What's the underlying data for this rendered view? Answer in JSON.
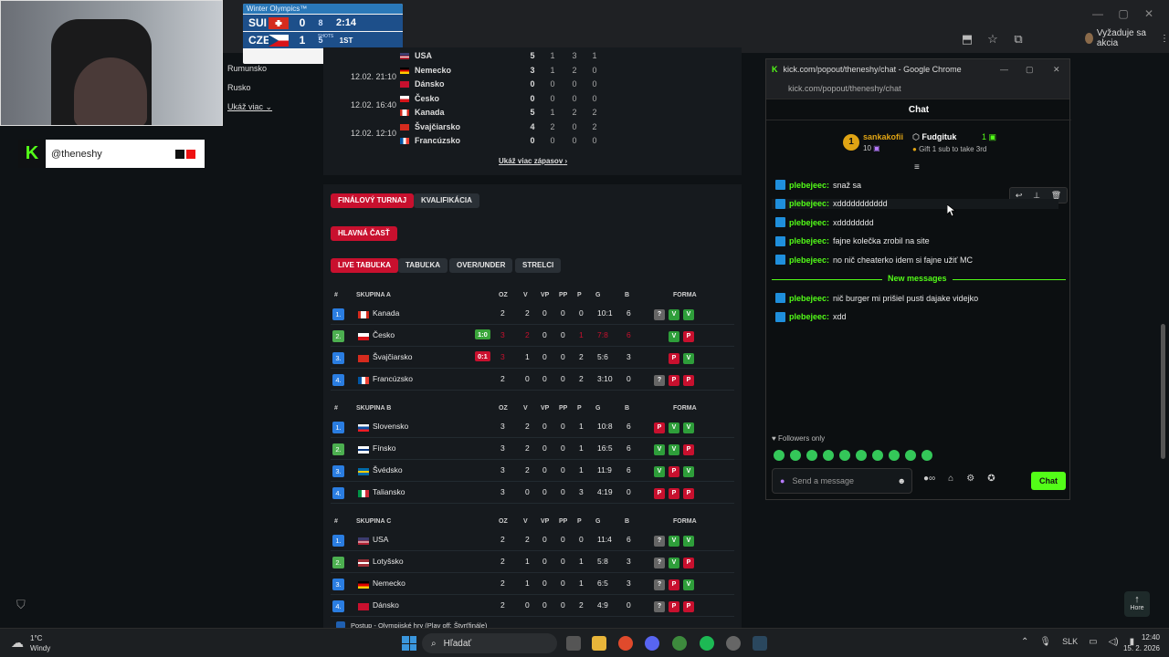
{
  "browser": {
    "action_label": "Vyžaduje sa akcia"
  },
  "scoreboard": {
    "header": "Winter Olympics™",
    "rows": [
      {
        "team": "SUI",
        "score": "0",
        "shots": "8",
        "clock": "2:14"
      },
      {
        "team": "CZE",
        "score": "1",
        "shots": "5",
        "clock": "1ST"
      }
    ],
    "shots_label": "SHOTS"
  },
  "channel": {
    "name": "@theneshy"
  },
  "side_list": [
    "Rumunsko",
    "Rusko",
    "Ukáž viac"
  ],
  "matches": {
    "rows": [
      {
        "time": "",
        "teams": [
          {
            "name": "USA",
            "nums": [
              "5",
              "1",
              "3",
              "1"
            ]
          }
        ]
      },
      {
        "time": "12.02. 21:10",
        "teams": [
          {
            "name": "Nemecko",
            "nums": [
              "3",
              "1",
              "2",
              "0"
            ]
          },
          {
            "name": "Dánsko",
            "nums": [
              "0",
              "0",
              "0",
              "0"
            ]
          }
        ]
      },
      {
        "time": "12.02. 16:40",
        "teams": [
          {
            "name": "Česko",
            "nums": [
              "0",
              "0",
              "0",
              "0"
            ]
          },
          {
            "name": "Kanada",
            "nums": [
              "5",
              "1",
              "2",
              "2"
            ]
          }
        ]
      },
      {
        "time": "12.02. 12:10",
        "teams": [
          {
            "name": "Švajčiarsko",
            "nums": [
              "4",
              "2",
              "0",
              "2"
            ]
          },
          {
            "name": "Francúzsko",
            "nums": [
              "0",
              "0",
              "0",
              "0"
            ]
          }
        ]
      }
    ],
    "more": "Ukáž viac zápasov"
  },
  "tabs": {
    "stage": [
      "FINÁLOVÝ TURNAJ",
      "KVALIFIKÁCIA"
    ],
    "part": "HLAVNÁ ČASŤ",
    "views": [
      "LIVE TABUĽKA",
      "TABUĽKA",
      "OVER/UNDER",
      "STRELCI"
    ]
  },
  "table_headers": {
    "rank": "#",
    "oz": "OZ",
    "v": "V",
    "vp": "VP",
    "pp": "PP",
    "p": "P",
    "g": "G",
    "b": "B",
    "forma": "FORMA"
  },
  "groups": [
    {
      "name": "SKUPINA A",
      "rows": [
        {
          "rank": "1.",
          "team": "Kanada",
          "live": "",
          "oz": "2",
          "v": "2",
          "vp": "0",
          "pp": "0",
          "p": "0",
          "g": "10:1",
          "b": "6",
          "forma": [
            "?",
            "V",
            "V"
          ]
        },
        {
          "rank": "2.",
          "team": "Česko",
          "live": "1:0",
          "oz": "3",
          "v": "2",
          "vp": "0",
          "pp": "0",
          "p": "1",
          "g": "7:8",
          "b": "6",
          "forma": [
            "V",
            "P"
          ]
        },
        {
          "rank": "3.",
          "team": "Švajčiarsko",
          "live": "0:1",
          "oz": "3",
          "v": "1",
          "vp": "0",
          "pp": "0",
          "p": "2",
          "g": "5:6",
          "b": "3",
          "forma": [
            "P",
            "V"
          ]
        },
        {
          "rank": "4.",
          "team": "Francúzsko",
          "live": "",
          "oz": "2",
          "v": "0",
          "vp": "0",
          "pp": "0",
          "p": "2",
          "g": "3:10",
          "b": "0",
          "forma": [
            "?",
            "P",
            "P"
          ]
        }
      ]
    },
    {
      "name": "SKUPINA B",
      "rows": [
        {
          "rank": "1.",
          "team": "Slovensko",
          "live": "",
          "oz": "3",
          "v": "2",
          "vp": "0",
          "pp": "0",
          "p": "1",
          "g": "10:8",
          "b": "6",
          "forma": [
            "P",
            "V",
            "V"
          ]
        },
        {
          "rank": "2.",
          "team": "Fínsko",
          "live": "",
          "oz": "3",
          "v": "2",
          "vp": "0",
          "pp": "0",
          "p": "1",
          "g": "16:5",
          "b": "6",
          "forma": [
            "V",
            "V",
            "P"
          ]
        },
        {
          "rank": "3.",
          "team": "Švédsko",
          "live": "",
          "oz": "3",
          "v": "2",
          "vp": "0",
          "pp": "0",
          "p": "1",
          "g": "11:9",
          "b": "6",
          "forma": [
            "V",
            "P",
            "V"
          ]
        },
        {
          "rank": "4.",
          "team": "Taliansko",
          "live": "",
          "oz": "3",
          "v": "0",
          "vp": "0",
          "pp": "0",
          "p": "3",
          "g": "4:19",
          "b": "0",
          "forma": [
            "P",
            "P",
            "P"
          ]
        }
      ]
    },
    {
      "name": "SKUPINA C",
      "rows": [
        {
          "rank": "1.",
          "team": "USA",
          "live": "",
          "oz": "2",
          "v": "2",
          "vp": "0",
          "pp": "0",
          "p": "0",
          "g": "11:4",
          "b": "6",
          "forma": [
            "?",
            "V",
            "V"
          ]
        },
        {
          "rank": "2.",
          "team": "Lotyšsko",
          "live": "",
          "oz": "2",
          "v": "1",
          "vp": "0",
          "pp": "0",
          "p": "1",
          "g": "5:8",
          "b": "3",
          "forma": [
            "?",
            "V",
            "P"
          ]
        },
        {
          "rank": "3.",
          "team": "Nemecko",
          "live": "",
          "oz": "2",
          "v": "1",
          "vp": "0",
          "pp": "0",
          "p": "1",
          "g": "6:5",
          "b": "3",
          "forma": [
            "?",
            "P",
            "V"
          ]
        },
        {
          "rank": "4.",
          "team": "Dánsko",
          "live": "",
          "oz": "2",
          "v": "0",
          "vp": "0",
          "pp": "0",
          "p": "2",
          "g": "4:9",
          "b": "0",
          "forma": [
            "?",
            "P",
            "P"
          ]
        }
      ]
    }
  ],
  "footnote": "Postup - Olympijské hry (Play off: Štvrťfinále)",
  "chat": {
    "window_title": "kick.com/popout/theneshy/chat - Google Chrome",
    "url": "kick.com/popout/theneshy/chat",
    "heading": "Chat",
    "pinned_user": "sankakofii",
    "pinned_count": "10",
    "gifter": "Fudgituk",
    "gifter_count": "1",
    "gift_text": "Gift 1 sub to take 3rd",
    "messages": [
      {
        "user": "plebejeec:",
        "text": "snaž sa"
      },
      {
        "user": "plebejeec:",
        "text": "xddddddddddd"
      },
      {
        "user": "plebejeec:",
        "text": "xdddddddd"
      },
      {
        "user": "plebejeec:",
        "text": "fajne kolečka zrobil na site"
      },
      {
        "user": "plebejeec:",
        "text": "no nič cheaterko idem si fajne užiť MC"
      }
    ],
    "new_messages_label": "New messages",
    "new_messages": [
      {
        "user": "plebejeec:",
        "text": "nič burger mi prišiel pusti dajake videjko"
      },
      {
        "user": "plebejeec:",
        "text": "xdd"
      }
    ],
    "followers_only": "Followers only",
    "placeholder": "Send a message",
    "send_label": "Chat"
  },
  "taskbar": {
    "weather_temp": "1°C",
    "weather_desc": "Windy",
    "search": "Hľadať",
    "lang": "SLK",
    "time": "12:40",
    "date": "15. 2. 2026",
    "hore": "Hore"
  }
}
